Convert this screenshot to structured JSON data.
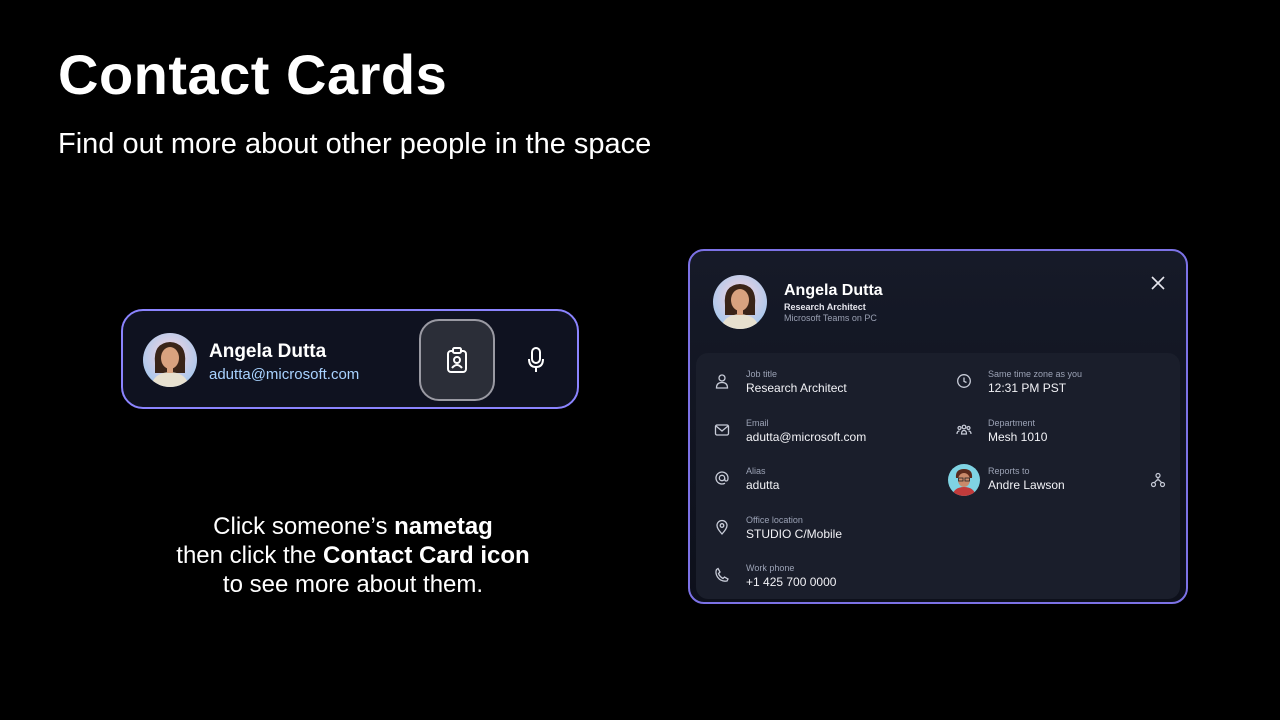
{
  "slide": {
    "title": "Contact Cards",
    "subtitle": "Find out more about other people in the space"
  },
  "nametag": {
    "name": "Angela Dutta",
    "email": "adutta@microsoft.com",
    "contact_card_icon": "contact-card-icon",
    "mic_icon": "microphone-icon"
  },
  "instructions": {
    "line1_prefix": "Click someone’s ",
    "line1_bold": "nametag",
    "line2_prefix": "then click the ",
    "line2_bold": "Contact Card icon",
    "line3": "to see more about them."
  },
  "contact_card": {
    "name": "Angela Dutta",
    "role": "Research Architect",
    "source": "Microsoft Teams on PC",
    "fields": {
      "job_title": {
        "label": "Job title",
        "value": "Research Architect",
        "icon": "person-icon"
      },
      "email": {
        "label": "Email",
        "value": "adutta@microsoft.com",
        "icon": "mail-icon"
      },
      "alias": {
        "label": "Alias",
        "value": "adutta",
        "icon": "at-icon"
      },
      "office_location": {
        "label": "Office location",
        "value": "STUDIO C/Mobile",
        "icon": "location-pin-icon"
      },
      "work_phone": {
        "label": "Work phone",
        "value": "+1 425 700 0000",
        "icon": "phone-icon"
      },
      "time_zone": {
        "label": "Same time zone as you",
        "value": "12:31 PM PST",
        "icon": "clock-icon"
      },
      "department": {
        "label": "Department",
        "value": "Mesh 1010",
        "icon": "people-group-icon"
      },
      "reports_to": {
        "label": "Reports to",
        "value": "Andre Lawson",
        "icon": "avatar"
      }
    }
  },
  "colors": {
    "accent_border": "#8b84ff",
    "email_link": "#a8d2ff",
    "background": "#000000"
  }
}
